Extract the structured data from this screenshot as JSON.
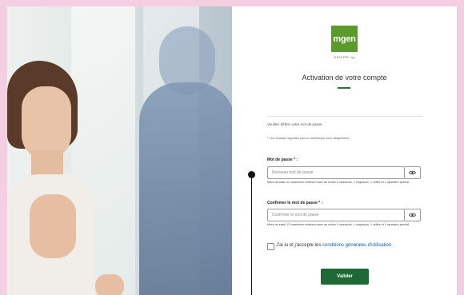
{
  "logo": {
    "text": "mgen",
    "subtext": "GROUPE vyv",
    "brand_color": "#5a9b2c"
  },
  "form": {
    "title": "Activation de votre compte",
    "intro": "Veuillez définir votre mot de passe",
    "required_note": "* Les champs signalés par un astérisque sont obligatoires",
    "password": {
      "label": "Mot de passe * :",
      "placeholder": "Nouveau mot de passe",
      "help": "Merci de saisir 12 caractères minimum avec au moins 1 minuscule, 1 majuscule, 1 chiffre et 1 caractère spécial."
    },
    "confirm": {
      "label": "Confirmer le mot de passe * :",
      "placeholder": "Confirmer le mot de passe",
      "help": "Merci de saisir 12 caractères minimum avec au moins 1 minuscule, 1 majuscule, 1 chiffre et 1 caractère spécial."
    },
    "terms": {
      "prefix": "J'ai lu et j'accepte les ",
      "link": "conditions générales d'utilisation",
      "suffix": "."
    },
    "submit_label": "Valider",
    "accent_color": "#1f6a34",
    "link_color": "#1f57a7"
  },
  "icons": {
    "password_toggle": "eye-icon",
    "confirm_toggle": "eye-icon"
  }
}
